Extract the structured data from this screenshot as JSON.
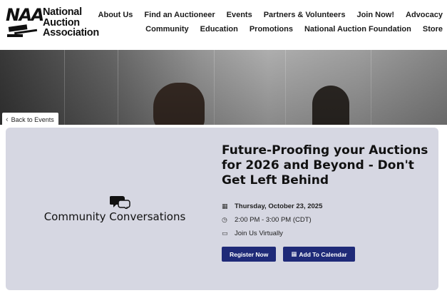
{
  "logo": {
    "mark": "NAA",
    "line1": "National",
    "line2": "Auction",
    "line3": "Association"
  },
  "nav": {
    "row1": [
      "About Us",
      "Find an Auctioneer",
      "Events",
      "Partners & Volunteers",
      "Join Now!",
      "Advocacy"
    ],
    "row2": [
      "Community",
      "Education",
      "Promotions",
      "National Auction Foundation",
      "Store"
    ]
  },
  "back": {
    "label": "Back to Events",
    "icon": "chevron-left-icon"
  },
  "event": {
    "category": "Community Conversations",
    "category_icon": "chat-bubbles-icon",
    "title": "Future-Proofing your Auctions for 2026 and Beyond - Don't Get Left Behind",
    "date": "Thursday, October 23, 2025",
    "time": "2:00 PM - 3:00 PM (CDT)",
    "location": "Join Us Virtually",
    "register_label": "Register Now",
    "calendar_label": "Add To Calendar"
  },
  "colors": {
    "card_bg": "#d6d7e2",
    "button_bg": "#1f2a78",
    "text": "#111111"
  }
}
